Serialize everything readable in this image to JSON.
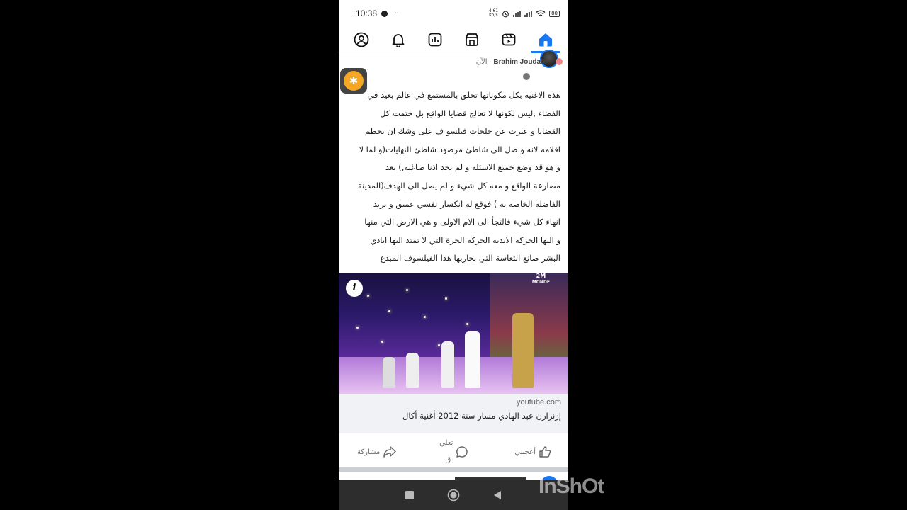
{
  "status_bar": {
    "time": "10:38",
    "speed_value": "4.61",
    "speed_unit": "Ko/s",
    "battery": "80"
  },
  "nav": {
    "icons": [
      "profile-icon",
      "notifications-icon",
      "dashboard-icon",
      "marketplace-icon",
      "video-icon",
      "home-icon"
    ],
    "active": "home-icon",
    "accent_color": "#1877f2"
  },
  "post": {
    "author": "Brahim Joudate",
    "time": "الآن",
    "separator": "·",
    "text_lines": [
      "هذه الاغنية بكل مكوناتها تحلق بالمستمع في عالم بعيد في",
      "الفضاء ,ليس لكونها لا تعالج قضايا الواقع بل ختمت كل",
      "القضايا و عبرت عن  خلجات فيلسو ف على وشك ان يحطم",
      "اقلامه لانه و صل الى شاطئ مرصود شاطئ النهايات(و لما لا",
      "و هو قد وضع جميع الاسئلة و لم يجد اذنا صاغية,) بعد",
      "مصارعة الواقع و معه كل شيء و لم يصل الى الهدف(المدينة",
      "الفاضلة الخاصة به ) فوقع له انكسار نفسي عميق و يريد",
      "انهاء كل شيء فالتجأ الى الام الاولى و هي الارض التي منها",
      "و اليها الحركة الابدية الحركة الحرة التي لا تمتد اليها ايادي",
      "البشر صانع التعاسة التي بحاربها هذا الفيلسوف المبدع"
    ],
    "video_logo_line1": "2M",
    "video_logo_line2": "MONDE",
    "info_label": "i",
    "link_domain": "youtube.com",
    "link_title": "إزنزارن عبد الهادي مسار سنة 2012 أغنية أكال"
  },
  "actions": {
    "like": "أعجبني",
    "comment_line1": "تعلي",
    "comment_line2": "ق",
    "share": "مشاركة"
  },
  "watermark": "InShOt"
}
